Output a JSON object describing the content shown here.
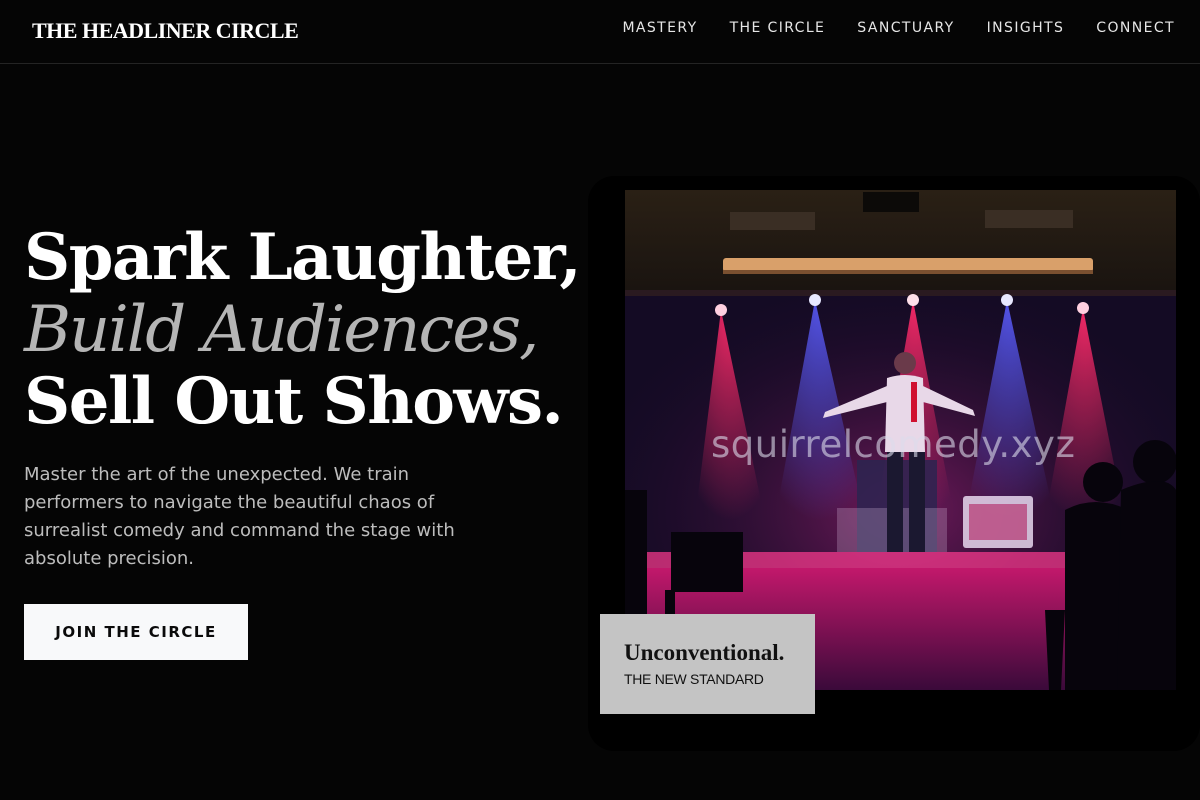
{
  "header": {
    "logo": "THE HEADLINER CIRCLE",
    "nav": [
      {
        "label": "MASTERY"
      },
      {
        "label": "THE CIRCLE"
      },
      {
        "label": "SANCTUARY"
      },
      {
        "label": "INSIGHTS"
      },
      {
        "label": "CONNECT"
      }
    ]
  },
  "hero": {
    "title_line_1": "Spark Laughter,",
    "title_line_2": "Build Audiences,",
    "title_line_3": "Sell Out Shows.",
    "subtitle": "Master the art of the unexpected. We train performers to navigate the beautiful chaos of surrealist comedy and command the stage with absolute precision.",
    "cta_label": "JOIN THE CIRCLE"
  },
  "media": {
    "photo_subject": "comedian-on-stage",
    "watermark": "squirrelcomedy.xyz"
  },
  "badge": {
    "title": "Unconventional.",
    "subtitle": "THE NEW STANDARD"
  },
  "colors": {
    "background": "#050505",
    "accent_italic": "#b5b5b5",
    "cta_background": "#f8f9fa",
    "badge_background": "#c4c4c4"
  }
}
